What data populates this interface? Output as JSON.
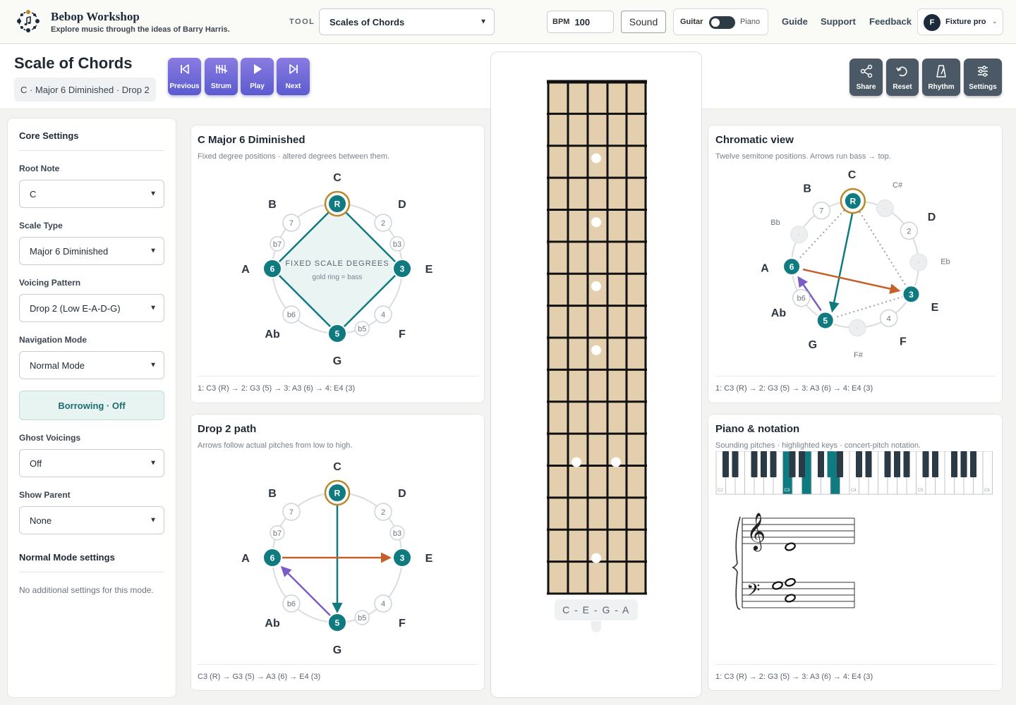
{
  "brand": {
    "title": "Bebop Workshop",
    "subtitle": "Explore music through the ideas of Barry Harris."
  },
  "topbar": {
    "tool_label": "TOOL",
    "tool_value": "Scales of Chords",
    "bpm_label": "BPM",
    "bpm_value": "100",
    "sound_label": "Sound",
    "toggle_left": "Guitar",
    "toggle_right": "Piano",
    "links": [
      "Guide",
      "Support",
      "Feedback"
    ],
    "account_initial": "F",
    "account_name": "Fixture pro"
  },
  "header": {
    "title": "Scale of Chords",
    "chip": "C · Major 6 Diminished · Drop 2",
    "playback": [
      "Previous",
      "Strum",
      "Play",
      "Next"
    ],
    "actions": [
      "Share",
      "Reset",
      "Rhythm",
      "Settings"
    ]
  },
  "sidebar": {
    "core_title": "Core Settings",
    "fields": [
      {
        "label": "Root Note",
        "value": "C"
      },
      {
        "label": "Scale Type",
        "value": "Major 6 Diminished"
      },
      {
        "label": "Voicing Pattern",
        "value": "Drop 2 (Low E-A-D-G)"
      },
      {
        "label": "Navigation Mode",
        "value": "Normal Mode"
      }
    ],
    "borrowing": "Borrowing · Off",
    "fields2": [
      {
        "label": "Ghost Voicings",
        "value": "Off"
      },
      {
        "label": "Show Parent",
        "value": "None"
      }
    ],
    "mode_title": "Normal Mode settings",
    "mode_note": "No additional settings for this mode."
  },
  "circle_panel": {
    "title": "C Major 6 Diminished",
    "subtitle": "Fixed degree positions · altered degrees between them.",
    "center_title": "FIXED SCALE DEGREES",
    "center_sub": "gold ring = bass",
    "footer": "1: C3 (R) → 2: G3 (5) → 3: A3 (6) → 4: E4 (3)"
  },
  "drop_panel": {
    "title": "Drop 2 path",
    "subtitle": "Arrows follow actual pitches from low to high.",
    "footer": "C3 (R) → G3 (5) → A3 (6) → E4 (3)"
  },
  "circle_labels": {
    "note_names": [
      "C",
      "D",
      "E",
      "F",
      "G",
      "Ab",
      "A",
      "B"
    ],
    "active": [
      "R",
      "3",
      "5",
      "6"
    ],
    "inactive": [
      "2",
      "b3",
      "4",
      "b5",
      "b6",
      "b7",
      "7"
    ]
  },
  "chromatic_panel": {
    "title": "Chromatic view",
    "subtitle": "Twelve semitone positions. Arrows run bass → top.",
    "notes_main": [
      "C",
      "D",
      "E",
      "F",
      "G",
      "Ab",
      "A",
      "B"
    ],
    "notes_small": [
      "C#",
      "Eb",
      "F#",
      "Bb"
    ],
    "inactive_marker": "·",
    "footer": "1: C3 (R) → 2: G3 (5) → 3: A3 (6) → 4: E4 (3)"
  },
  "piano_panel": {
    "title": "Piano & notation",
    "subtitle": "Sounding pitches · highlighted keys · concert-pitch notation.",
    "octave_labels": [
      "C2",
      "C3",
      "C4",
      "C5",
      "C6"
    ],
    "footer": "1: C3 (R) → 2: G3 (5) → 3: A3 (6) → 4: E4 (3)"
  },
  "fretboard": {
    "chord_notes": "C - E - G - A"
  },
  "colors": {
    "teal": "#0f7a80",
    "gold": "#b8892b",
    "purple": "#7a5cc8",
    "orange": "#c4602a",
    "fret_wood": "#e3cfae"
  }
}
